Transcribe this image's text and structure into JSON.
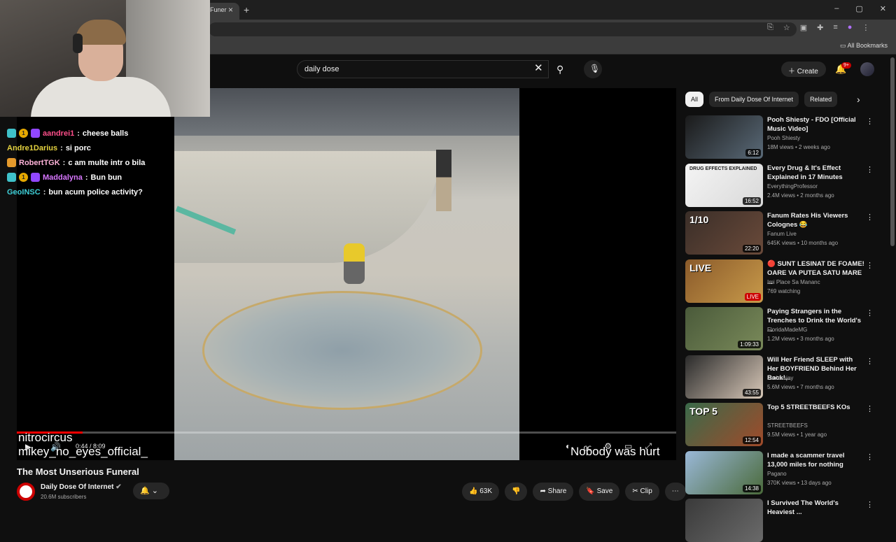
{
  "browser": {
    "tab_title": "Funer",
    "tab_close": "×",
    "new_tab": "+",
    "window_controls": [
      "–",
      "▢",
      "✕"
    ],
    "all_bookmarks": "All Bookmarks"
  },
  "youtube": {
    "search_value": "daily dose",
    "create_label": "Create",
    "notification_count": "9+"
  },
  "chat": [
    {
      "user": "aandrei1",
      "color": "#ff4f8a",
      "msg": "cheese balls",
      "badges": [
        "sq",
        "coin",
        "bits"
      ]
    },
    {
      "user": "Andre1Darius",
      "color": "#e5d340",
      "msg": "si porc",
      "badges": []
    },
    {
      "user": "RobertTGK",
      "color": "#ffb3d9",
      "msg": "c am multe intr o bila",
      "badges": [
        "vip"
      ]
    },
    {
      "user": "Maddalyna",
      "color": "#d877ff",
      "msg": "Bun bun",
      "badges": [
        "sq",
        "coin",
        "bits"
      ]
    },
    {
      "user": "GeoINSC",
      "color": "#3fd0d8",
      "msg": "bun acum police activity?",
      "badges": []
    }
  ],
  "player": {
    "overlay_1": "nitrocircus",
    "overlay_2": "mikey_no_eyes_official_",
    "overlay_3": "Nobody was hurt",
    "time": "0:44 / 8:09",
    "progress": 0.1
  },
  "video": {
    "title": "The Most Unserious Funeral",
    "channel": "Daily Dose Of Internet",
    "subscribers": "20.6M subscribers",
    "likes": "63K",
    "share": "Share",
    "save": "Save",
    "clip": "Clip"
  },
  "chips": [
    "All",
    "From Daily Dose Of Internet",
    "Related"
  ],
  "recommendations": [
    {
      "title": "Pooh Shiesty - FDO [Official Music Video]",
      "channel": "Pooh Shiesty",
      "meta": "18M views • 2 weeks ago",
      "duration": "6:12",
      "colors": [
        "#1a1a1a",
        "#5a6a78"
      ]
    },
    {
      "title": "Every Drug & It's Effect Explained in 17 Minutes",
      "channel": "EverythingProfessor",
      "meta": "2.4M views • 2 months ago",
      "duration": "16:52",
      "colors": [
        "#f4f4f4",
        "#d9d9d9"
      ],
      "thumb_text": "DRUG EFFECTS EXPLAINED"
    },
    {
      "title": "Fanum Rates His Viewers Colognes 😂",
      "channel": "Fanum Live",
      "meta": "645K views • 10 months ago",
      "duration": "22:20",
      "colors": [
        "#3a2e28",
        "#6a4a3a"
      ],
      "thumb_text": "1/10"
    },
    {
      "title": "🔴 SUNT LESINAT DE FOAME! OARE VA PUTEA SATU MARE ...",
      "channel": "Imi Place Sa Mananc",
      "meta": "769 watching",
      "duration": "LIVE",
      "colors": [
        "#8a5a2a",
        "#c89a4a"
      ],
      "thumb_text": "LIVE"
    },
    {
      "title": "Paying Strangers in the Trenches to Drink the World's ...",
      "channel": "FloridaMadeMG",
      "meta": "1.2M views • 3 months ago",
      "duration": "1:09:33",
      "colors": [
        "#4a5a3a",
        "#7a8a5a"
      ]
    },
    {
      "title": "Will Her Friend SLEEP with Her BOYFRIEND Behind Her Back!...",
      "channel": "soulessjay",
      "meta": "5.6M views • 7 months ago",
      "duration": "43:55",
      "colors": [
        "#2a2a2a",
        "#d8c8b8"
      ]
    },
    {
      "title": "Top 5 STREETBEEFS KOs",
      "channel": "STREETBEEFS",
      "meta": "9.5M views • 1 year ago",
      "duration": "12:54",
      "colors": [
        "#3a6a4a",
        "#a04a2a"
      ],
      "thumb_text": "TOP 5"
    },
    {
      "title": "I made a scammer travel 13,000 miles for nothing",
      "channel": "Pagano",
      "meta": "370K views • 13 days ago",
      "duration": "14:38",
      "colors": [
        "#9ab8d8",
        "#4a6a3a"
      ]
    },
    {
      "title": "I Survived The World's Heaviest ...",
      "channel": "",
      "meta": "",
      "duration": "",
      "colors": [
        "#3a3a3a",
        "#6a6a6a"
      ]
    }
  ]
}
